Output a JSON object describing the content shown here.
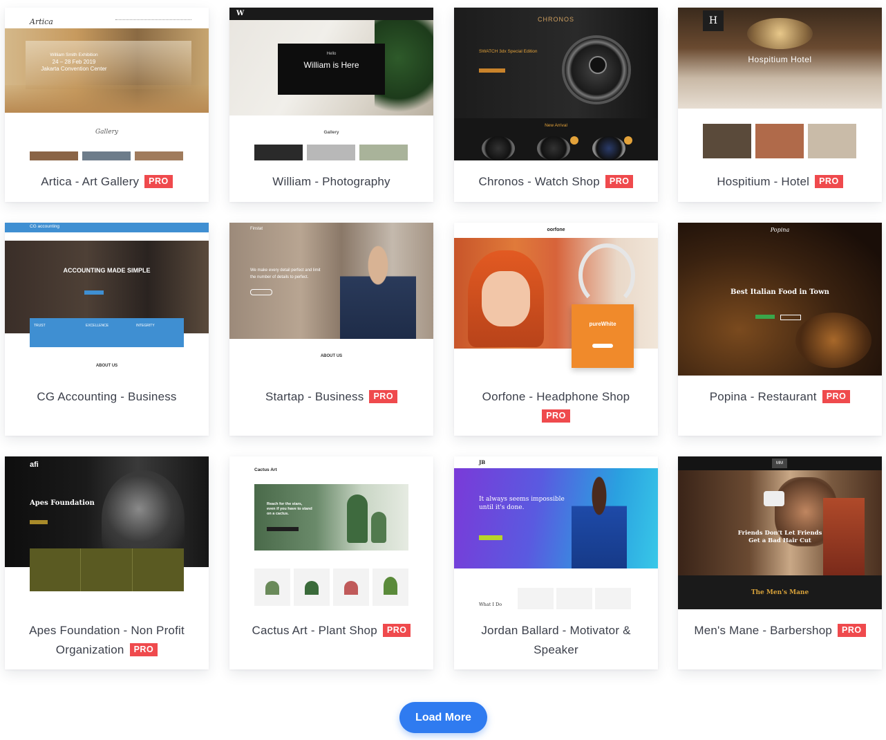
{
  "templates": [
    {
      "title": "Artica - Art Gallery",
      "pro": true,
      "logo": "Artica",
      "hero_lines": [
        "William Smith Exhibition",
        "24 – 28 Feb 2019",
        "Jakarta Convention Center"
      ],
      "section": "Gallery"
    },
    {
      "title": "William - Photography",
      "pro": false,
      "logo": "W",
      "hero_lines": [
        "Hello",
        "William is Here"
      ],
      "section": "Gallery"
    },
    {
      "title": "Chronos - Watch Shop",
      "pro": true,
      "logo": "CHRONOS",
      "hero_lines": [
        "SWATCH 3dx Special Edition"
      ],
      "section": "New Arrival"
    },
    {
      "title": "Hospitium - Hotel",
      "pro": true,
      "logo": "H",
      "hero_lines": [
        "Hospitium Hotel"
      ]
    },
    {
      "title": "CG Accounting - Business",
      "pro": false,
      "logo": "CG accounting",
      "hero_lines": [
        "ACCOUNTING MADE SIMPLE"
      ],
      "features": [
        "TRUST",
        "EXCELLENCE",
        "INTEGRITY"
      ],
      "section": "ABOUT US"
    },
    {
      "title": "Startap - Business",
      "pro": true,
      "logo": "Finstat",
      "hero_lines": [
        "We make every detail perfect and limit",
        "the number of details to perfect."
      ],
      "section": "ABOUT US"
    },
    {
      "title": "Oorfone - Headphone Shop",
      "pro": true,
      "logo": "oorfone",
      "hero_lines": [
        "pureWhite"
      ]
    },
    {
      "title": "Popina - Restaurant",
      "pro": true,
      "logo": "Popina",
      "hero_lines": [
        "Best Italian Food in Town"
      ]
    },
    {
      "title": "Apes Foundation - Non Profit Organization",
      "pro": true,
      "logo": "afi",
      "hero_lines": [
        "Apes Foundation"
      ]
    },
    {
      "title": "Cactus Art - Plant Shop",
      "pro": true,
      "logo": "Cactus Art",
      "hero_lines": [
        "Reach for the stars,",
        "even if you have to stand",
        "on a cactus."
      ]
    },
    {
      "title": "Jordan Ballard - Motivator & Speaker",
      "pro": false,
      "logo": "JB",
      "hero_lines": [
        "It always seems impossible",
        "until it's done."
      ],
      "section": "What I Do"
    },
    {
      "title": "Men's Mane - Barbershop",
      "pro": true,
      "logo": "MM",
      "hero_lines": [
        "Friends Don't Let Friends",
        "Get a Bad Hair Cut"
      ],
      "section": "The Men's Mane"
    }
  ],
  "pro_label": "PRO",
  "load_more_label": "Load More",
  "colors": {
    "accent": "#2f7bf0",
    "pro_badge": "#ef4a4d",
    "text": "#3b3f4a"
  }
}
